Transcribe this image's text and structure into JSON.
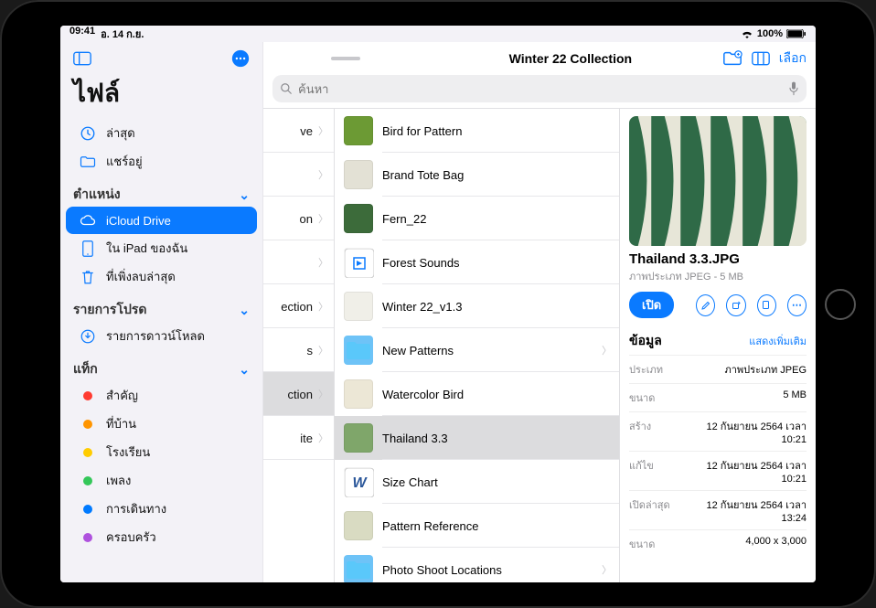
{
  "status": {
    "time": "09:41",
    "date": "อ. 14 ก.ย.",
    "battery": "100%"
  },
  "sidebar": {
    "app_title": "ไฟล์",
    "recents": "ล่าสุด",
    "shared": "แชร์อยู่",
    "section_locations": "ตำแหน่ง",
    "icloud": "iCloud Drive",
    "on_ipad": "ใน iPad ของฉัน",
    "recently_deleted": "ที่เพิ่งลบล่าสุด",
    "section_favs": "รายการโปรด",
    "downloads": "รายการดาวน์โหลด",
    "section_tags": "แท็ก",
    "tags": [
      {
        "label": "สำคัญ",
        "color": "#ff3b30"
      },
      {
        "label": "ที่บ้าน",
        "color": "#ff9500"
      },
      {
        "label": "โรงเรียน",
        "color": "#ffcc00"
      },
      {
        "label": "เพลง",
        "color": "#34c759"
      },
      {
        "label": "การเดินทาง",
        "color": "#007aff"
      },
      {
        "label": "ครอบครัว",
        "color": "#af52de"
      }
    ]
  },
  "header": {
    "title": "Winter 22 Collection",
    "select": "เลือก"
  },
  "search": {
    "placeholder": "ค้นหา"
  },
  "col1": {
    "rows": [
      "ve",
      "",
      "on",
      "",
      "ection",
      "s",
      "ction",
      "ite"
    ],
    "selected_index": 6
  },
  "col2": {
    "rows": [
      {
        "name": "Bird for Pattern",
        "kind": "img",
        "thumb_color": "#6c9a34"
      },
      {
        "name": "Brand Tote Bag",
        "kind": "img",
        "thumb_color": "#e3e1d5"
      },
      {
        "name": "Fern_22",
        "kind": "img",
        "thumb_color": "#3c6b3a"
      },
      {
        "name": "Forest Sounds",
        "kind": "audio",
        "thumb_color": "#ffffff"
      },
      {
        "name": "Winter 22_v1.3",
        "kind": "doc",
        "thumb_color": "#f0efe8"
      },
      {
        "name": "New Patterns",
        "kind": "folder",
        "thumb_color": "#6ec3f7"
      },
      {
        "name": "Watercolor Bird",
        "kind": "img",
        "thumb_color": "#ece7d6"
      },
      {
        "name": "Thailand 3.3",
        "kind": "img",
        "thumb_color": "#7fa66a"
      },
      {
        "name": "Size Chart",
        "kind": "word",
        "thumb_color": "#ffffff"
      },
      {
        "name": "Pattern Reference",
        "kind": "img",
        "thumb_color": "#d9dbc2"
      },
      {
        "name": "Photo Shoot Locations",
        "kind": "folder",
        "thumb_color": "#6ec3f7"
      }
    ],
    "selected_index": 7
  },
  "info": {
    "filename": "Thailand 3.3.JPG",
    "subtitle": "ภาพประเภท JPEG - 5 MB",
    "open_label": "เปิด",
    "section_title": "ข้อมูล",
    "show_more": "แสดงเพิ่มเติม",
    "rows": [
      {
        "k": "ประเภท",
        "v": "ภาพประเภท JPEG"
      },
      {
        "k": "ขนาด",
        "v": "5 MB"
      },
      {
        "k": "สร้าง",
        "v": "12 กันยายน 2564 เวลา 10:21"
      },
      {
        "k": "แก้ไข",
        "v": "12 กันยายน 2564 เวลา 10:21"
      },
      {
        "k": "เปิดล่าสุด",
        "v": "12 กันยายน 2564 เวลา 13:24"
      },
      {
        "k": "ขนาด",
        "v": "4,000 x 3,000"
      }
    ]
  }
}
